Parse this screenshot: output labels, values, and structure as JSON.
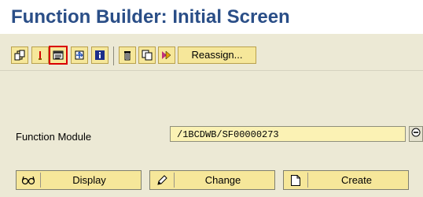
{
  "title": "Function Builder: Initial Screen",
  "toolbar": {
    "icons": [
      {
        "name": "where-used-icon"
      },
      {
        "name": "test-execute-icon"
      },
      {
        "name": "copy-display-icon"
      },
      {
        "name": "navigate-icon"
      },
      {
        "name": "info-icon"
      },
      {
        "name": "delete-icon"
      },
      {
        "name": "copy-icon"
      },
      {
        "name": "rename-icon"
      }
    ],
    "reassign_label": "Reassign..."
  },
  "function_module": {
    "label": "Function Module",
    "value": "/1BCDWB/SF00000273"
  },
  "actions": {
    "display_label": "Display",
    "change_label": "Change",
    "create_label": "Create"
  },
  "colors": {
    "title": "#2a4e87",
    "background": "#ece9d5",
    "button_fill": "#f6e79a",
    "input_fill": "#fbf2b4",
    "selected_border": "#d90000"
  }
}
